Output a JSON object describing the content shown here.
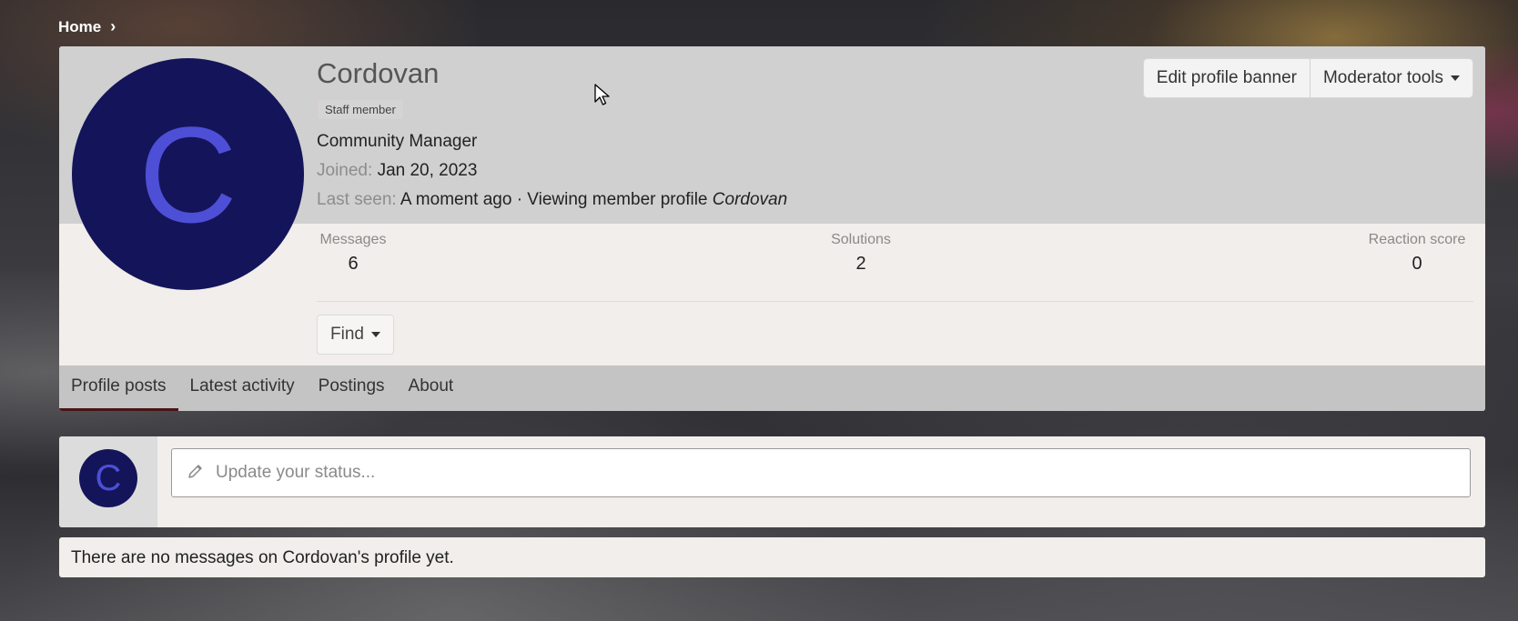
{
  "breadcrumb": {
    "home": "Home"
  },
  "profile": {
    "avatar_letter": "C",
    "name": "Cordovan",
    "badge": "Staff member",
    "title": "Community Manager",
    "joined_label": "Joined:",
    "joined_value": "Jan 20, 2023",
    "last_seen_label": "Last seen:",
    "last_seen_value": "A moment ago · Viewing member profile",
    "last_seen_target": "Cordovan",
    "avatar_bg": "#14145a",
    "avatar_fg": "#4d4fd6"
  },
  "banner_actions": {
    "edit_banner": "Edit profile banner",
    "moderator_tools": "Moderator tools"
  },
  "stats": [
    {
      "label": "Messages",
      "value": "6"
    },
    {
      "label": "Solutions",
      "value": "2"
    },
    {
      "label": "Reaction score",
      "value": "0"
    }
  ],
  "find": {
    "label": "Find"
  },
  "tabs": [
    {
      "label": "Profile posts",
      "active": true
    },
    {
      "label": "Latest activity",
      "active": false
    },
    {
      "label": "Postings",
      "active": false
    },
    {
      "label": "About",
      "active": false
    }
  ],
  "status": {
    "placeholder": "Update your status..."
  },
  "empty_message": "There are no messages on Cordovan's profile yet."
}
